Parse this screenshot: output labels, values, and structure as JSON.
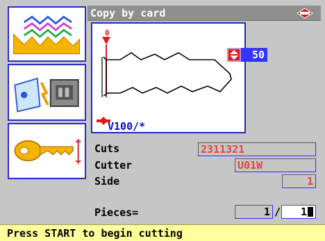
{
  "window": {
    "title": "Copy by card",
    "logo_text": "SILCA"
  },
  "tools": [
    {
      "name": "key-profile-tool",
      "icon": "cutter-profile-icon"
    },
    {
      "name": "card-copy-tool",
      "icon": "card-reader-icon"
    },
    {
      "name": "key-measure-tool",
      "icon": "key-icon"
    }
  ],
  "preview": {
    "depth_value": "50",
    "key_code": "V100/*",
    "marker_label": "0"
  },
  "fields": {
    "cuts_label": "Cuts",
    "cuts_value": "2311321",
    "cutter_label": "Cutter",
    "cutter_value": "U01W",
    "side_label": "Side",
    "side_value": "1",
    "pieces_label": "Pieces=",
    "pieces_done": "1",
    "pieces_slash": "/",
    "pieces_total": "1"
  },
  "status": {
    "message": "Press START to begin cutting"
  },
  "colors": {
    "accent_blue": "#2d2dff",
    "field_red": "#f04040",
    "status_bg": "#ffff9c",
    "title_bg": "#8f8f8f"
  }
}
